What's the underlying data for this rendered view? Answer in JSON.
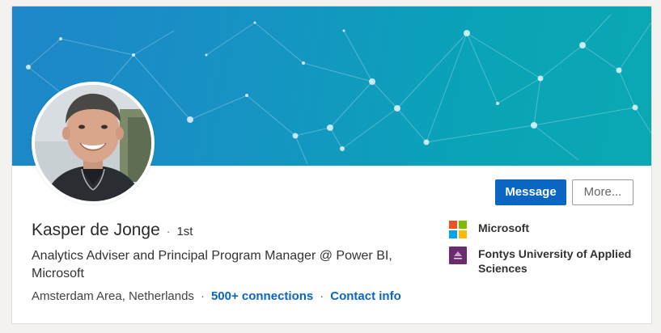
{
  "profile": {
    "name": "Kasper de Jonge",
    "degree_separator": "·",
    "degree": "1st",
    "headline": "Analytics Adviser and Principal Program Manager @ Power BI, Microsoft",
    "location": "Amsterdam Area, Netherlands",
    "meta_separator": "·",
    "connections": "500+ connections",
    "contact_info": "Contact info"
  },
  "actions": {
    "message_label": "Message",
    "more_label": "More..."
  },
  "side": {
    "items": [
      {
        "label": "Microsoft",
        "logo": "microsoft-logo"
      },
      {
        "label": "Fontys University of Applied Sciences",
        "logo": "fontys-logo"
      }
    ]
  },
  "colors": {
    "accent": "#0a66c2",
    "banner_start": "#1e86c9",
    "banner_end": "#0aa8b3",
    "fontys_purple": "#6a2c6e"
  }
}
